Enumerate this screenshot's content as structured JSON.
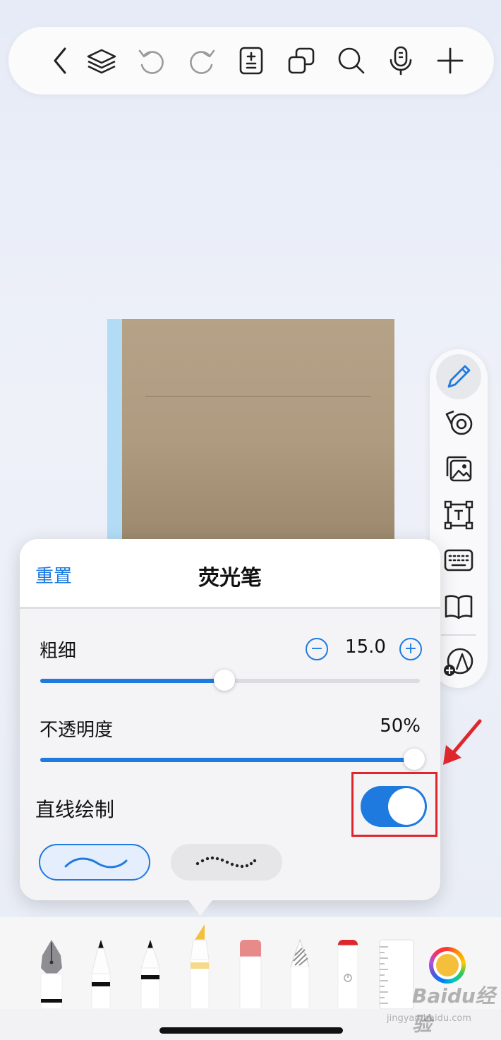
{
  "popup": {
    "reset_label": "重置",
    "title": "荧光笔",
    "thickness": {
      "label": "粗细",
      "value": "15.0",
      "fraction": 0.486
    },
    "opacity": {
      "label": "不透明度",
      "value": "50%",
      "fraction": 0.985
    },
    "straight_line": {
      "label": "直线绘制",
      "enabled": true
    }
  },
  "top_toolbar": {
    "icons": [
      "back-icon",
      "layers-icon",
      "undo-icon",
      "redo-icon",
      "page-add-icon",
      "duplicate-icon",
      "search-icon",
      "microphone-icon",
      "add-icon"
    ]
  },
  "side_toolbar": {
    "icons": [
      "pen-icon",
      "tape-icon",
      "image-icon",
      "text-box-icon",
      "keyboard-icon",
      "book-icon",
      "add-shape-icon"
    ],
    "active": "pen-icon"
  },
  "tools": [
    "fountain-pen",
    "ballpoint-pen",
    "fineliner",
    "highlighter",
    "eraser",
    "pencil",
    "laser-pointer",
    "ruler"
  ],
  "selected_tool": "highlighter",
  "current_color": "#f4bf3a",
  "colors": {
    "accent": "#1f7ae0",
    "annotation_red": "#e0262d"
  },
  "watermark": {
    "brand": "Baidu经验",
    "sub": "jingyan.baidu.com"
  }
}
